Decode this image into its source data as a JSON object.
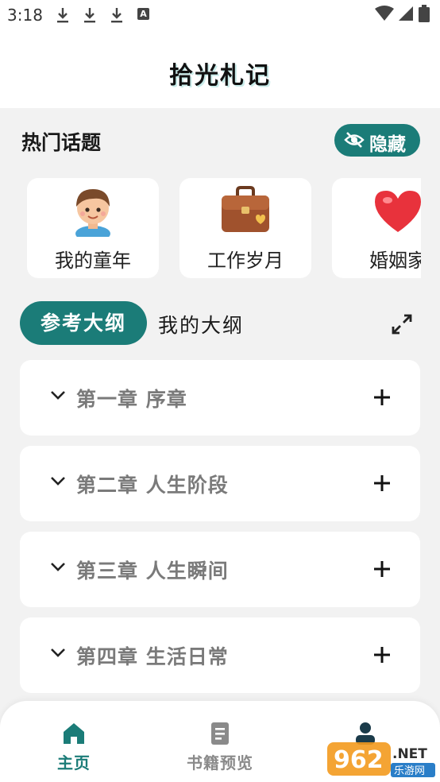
{
  "status_bar": {
    "time": "3:18",
    "badge_letter": "A"
  },
  "header": {
    "title": "拾光札记"
  },
  "hot_topics": {
    "title": "热门话题",
    "hide_label": "隐藏",
    "items": [
      {
        "label": "我的童年",
        "icon": "child-avatar-icon"
      },
      {
        "label": "工作岁月",
        "icon": "briefcase-icon"
      },
      {
        "label": "婚姻家",
        "icon": "heart-icon"
      }
    ]
  },
  "outline_tabs": {
    "active": "参考大纲",
    "inactive": "我的大纲"
  },
  "chapters": [
    {
      "title": "第一章 序章"
    },
    {
      "title": "第二章 人生阶段"
    },
    {
      "title": "第三章 人生瞬间"
    },
    {
      "title": "第四章 生活日常"
    }
  ],
  "bottom_nav": [
    {
      "label": "主页",
      "icon": "home-icon",
      "active": true
    },
    {
      "label": "书籍预览",
      "icon": "book-icon",
      "active": false
    }
  ],
  "watermark": {
    "brand": "962.NET",
    "sub": "乐游网"
  },
  "colors": {
    "accent": "#1b7c78",
    "background": "#f2f2f2",
    "card": "#ffffff",
    "muted_text": "#7a7a7a"
  }
}
